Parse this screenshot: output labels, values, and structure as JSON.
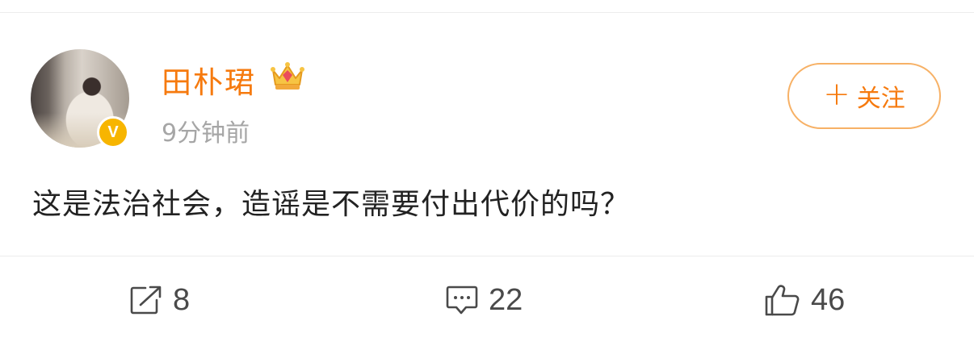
{
  "user": {
    "name": "田朴珺",
    "verified_badge": "V",
    "timestamp": "9分钟前"
  },
  "follow_button": {
    "plus": "+",
    "label": "关注"
  },
  "post": {
    "text": "这是法治社会，造谣是不需要付出代价的吗？"
  },
  "actions": {
    "repost_count": "8",
    "comment_count": "22",
    "like_count": "46"
  },
  "colors": {
    "accent": "#f67a0e",
    "badge": "#f7b500",
    "text": "#222222",
    "muted": "#a6a6a6"
  },
  "icons": [
    "verified-icon",
    "crown-icon",
    "plus-icon",
    "repost-icon",
    "comment-icon",
    "like-icon"
  ]
}
